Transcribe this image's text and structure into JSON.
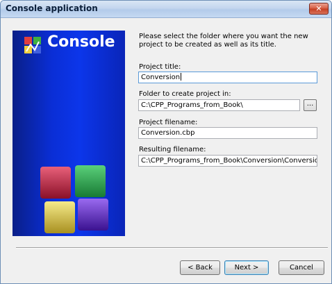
{
  "window": {
    "title": "Console application",
    "close_glyph": "✕"
  },
  "banner": {
    "title": "Console",
    "logo_icon": "codeblocks-logo-icon",
    "cube_colors": [
      "#c0203a",
      "#26a04a",
      "#d8c43a",
      "#6a2ad0"
    ]
  },
  "form": {
    "instructions": "Please select the folder where you want the new project to be created as well as its title.",
    "project_title_label": "Project title:",
    "project_title_value": "Conversion",
    "folder_label": "Folder to create project in:",
    "folder_value": "C:\\CPP_Programs_from_Book\\",
    "browse_label": "...",
    "filename_label": "Project filename:",
    "filename_value": "Conversion.cbp",
    "resulting_label": "Resulting filename:",
    "resulting_value": "C:\\CPP_Programs_from_Book\\Conversion\\Conversion.cbp"
  },
  "buttons": {
    "back": "< Back",
    "next": "Next >",
    "cancel": "Cancel"
  }
}
